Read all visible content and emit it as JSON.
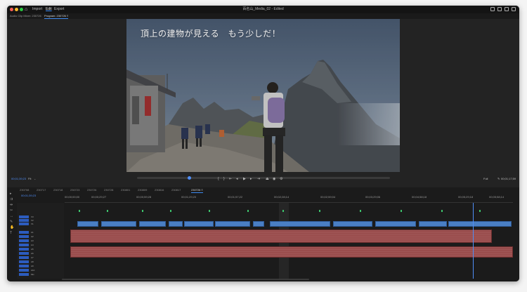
{
  "window": {
    "title": "百名山_Media_02 - Edited",
    "menu_tabs": [
      "Import",
      "Edit",
      "Export"
    ],
    "active_menu_tab": "Edit"
  },
  "panels": {
    "tabs": [
      "Audio Clip Mixer: 230726",
      "Program: 230726 ≡"
    ],
    "active_tab": "Program: 230726 ≡"
  },
  "program_monitor": {
    "subtitle": "頂上の建物が見える　もう少しだ！",
    "timecode_left": "00;01;39;23",
    "fit_label": "Fit",
    "quality_label": "Full",
    "timecode_right": "00;01;17;59"
  },
  "timeline": {
    "sequence_tabs": [
      "230708",
      "230717",
      "230718",
      "230723",
      "230726",
      "230728",
      "230801",
      "230809",
      "230816",
      "230817",
      "230726 ≡"
    ],
    "active_sequence_tab": "230726 ≡",
    "current_timecode": "00;01;39;23",
    "ruler_labels": [
      "00;00;00;00",
      "00;00;29;27",
      "00;00;59;28",
      "00;01;29;20",
      "00;01;57;22",
      "00;02;28;14",
      "00;02;59;04",
      "00;03;29;06",
      "00;04;58;18",
      "00;05;29;18",
      "00;05;58;14",
      "00;06;29;10",
      "00;07;00;08"
    ],
    "video_tracks": [
      "V3",
      "V2",
      "V1"
    ],
    "audio_tracks": [
      "A1",
      "A2",
      "A3",
      "A4",
      "A5",
      "A6",
      "A7",
      "A8",
      "A9",
      "A10",
      "Mix"
    ]
  },
  "colors": {
    "accent": "#4f8ef7",
    "video_clip": "#4a7fc4",
    "audio_clip": "#9a4d4d",
    "marker": "#3cc26b"
  }
}
